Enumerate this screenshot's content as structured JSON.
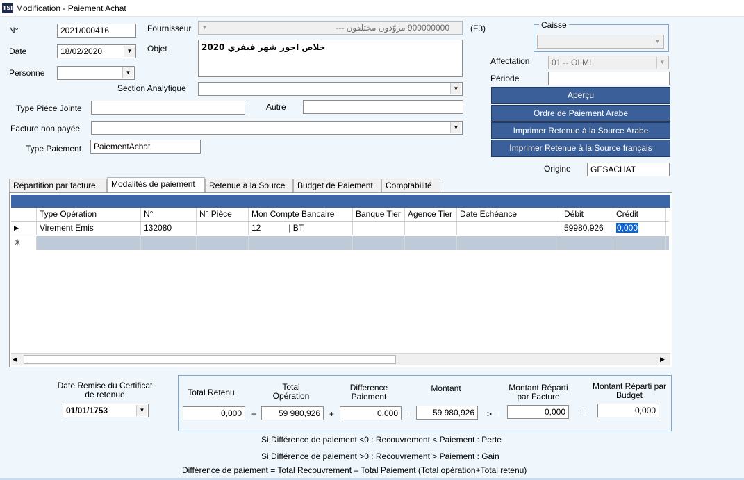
{
  "window": {
    "title": "Modification - Paiement Achat",
    "icon_text": "TSI"
  },
  "form": {
    "no_label": "N°",
    "no_value": "2021/000416",
    "date_label": "Date",
    "date_value": "18/02/2020",
    "personne_label": "Personne",
    "personne_value": "",
    "fournisseur_label": "Fournisseur",
    "fournisseur_value": "900000000 مزوّدون مختلفون ---",
    "f3_label": "(F3)",
    "objet_label": "Objet",
    "objet_value": "خلاص اجور شهر فيفري 2020",
    "section_label": "Section Analytique",
    "section_value": "",
    "type_piece_label": "Type Piéce Jointe",
    "type_piece_value": "",
    "autre_label": "Autre",
    "autre_value": "",
    "facture_label": "Facture non payée",
    "facture_value": "",
    "type_paiement_label": "Type Paiement",
    "type_paiement_value": "PaiementAchat"
  },
  "right_panel": {
    "caisse_label": "Caisse",
    "caisse_value": "",
    "affectation_label": "Affectation",
    "affectation_value": "01 -- OLMI",
    "periode_label": "Période",
    "periode_value": "",
    "buttons": [
      "Aperçu",
      "Ordre de Paiement Arabe",
      "Imprimer Retenue à la Source Arabe",
      "Imprimer Retenue à la Source français"
    ],
    "origine_label": "Origine",
    "origine_value": "GESACHAT"
  },
  "tabs": [
    "Répartition par facture",
    "Modalités de paiement",
    "Retenue à la Source",
    "Budget de Paiement",
    "Comptabilité"
  ],
  "grid": {
    "columns": [
      "Type Opération",
      "N°",
      "N° Pièce",
      "Mon Compte Bancaire",
      "Banque Tier",
      "Agence Tier",
      "Date Echéance",
      "Débit",
      "Crédit"
    ],
    "row": [
      "Virement Emis",
      "132080",
      "",
      "12            | BT",
      "",
      "",
      "",
      "59980,926",
      "0,000"
    ],
    "row_marker": "▶",
    "new_marker": "✳"
  },
  "bottom": {
    "date_remise_label": "Date Remise du Certificat de retenue",
    "date_remise_value": "01/01/1753",
    "total_retenu_label": "Total Retenu",
    "total_retenu_value": "0,000",
    "total_operation_label": "Total Opération",
    "total_operation_value": "59 980,926",
    "difference_label": "Difference Paiement",
    "difference_value": "0,000",
    "montant_label": "Montant",
    "montant_value": "59 980,926",
    "montant_facture_label": "Montant Réparti par Facture",
    "montant_facture_value": "0,000",
    "montant_budget_label": "Montant Réparti par Budget",
    "montant_budget_value": "0,000",
    "op_plus1": "+",
    "op_plus2": "+",
    "op_eq1": "=",
    "op_ge": ">=",
    "op_eq2": "=",
    "note1": "Si Différence de paiement <0 : Recouvrement < Paiement : Perte",
    "note2": "Si Différence de paiement >0 : Recouvrement > Paiement : Gain",
    "note3": "Différence de paiement = Total Recouvrement – Total Paiement (Total opération+Total retenu)"
  },
  "colors": {
    "accent": "#3b5f99",
    "grid_bar": "#3c66a5",
    "group_border": "#7aa8d6"
  }
}
